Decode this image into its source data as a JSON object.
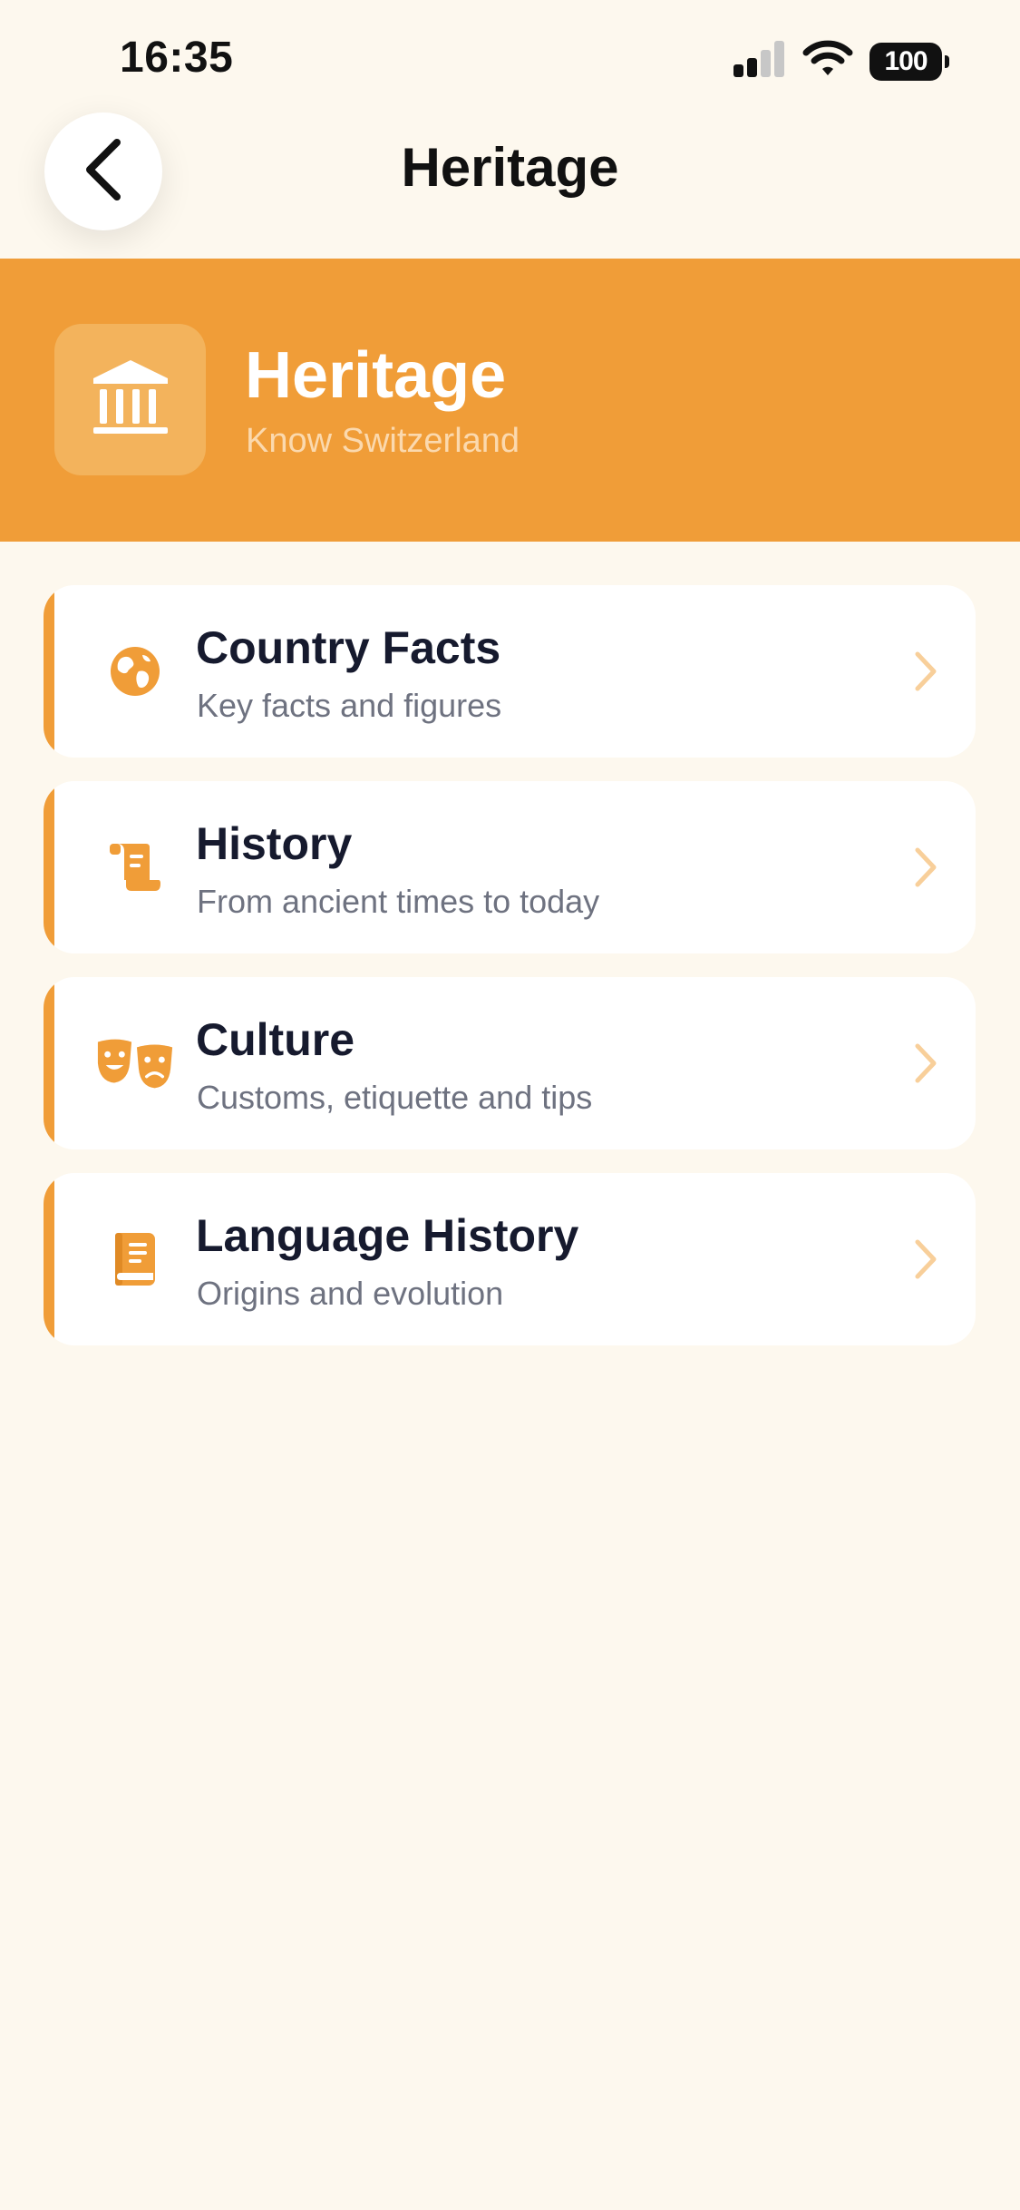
{
  "status_bar": {
    "time": "16:35",
    "battery": "100"
  },
  "nav": {
    "title": "Heritage",
    "back_icon": "chevron-left-icon"
  },
  "banner": {
    "title": "Heritage",
    "subtitle": "Know Switzerland",
    "icon": "landmark-icon"
  },
  "cards": [
    {
      "title": "Country Facts",
      "subtitle": "Key facts and figures",
      "icon": "globe-icon"
    },
    {
      "title": "History",
      "subtitle": "From ancient times to today",
      "icon": "scroll-icon"
    },
    {
      "title": "Culture",
      "subtitle": "Customs, etiquette and tips",
      "icon": "theater-masks-icon"
    },
    {
      "title": "Language History",
      "subtitle": "Origins and evolution",
      "icon": "book-icon"
    }
  ],
  "colors": {
    "accent": "#F09D38",
    "background": "#FDF8EE",
    "card": "#FFFFFF",
    "title_text": "#161A2E",
    "subtitle_text": "#6E7280",
    "chevron": "#F8CF9A"
  }
}
